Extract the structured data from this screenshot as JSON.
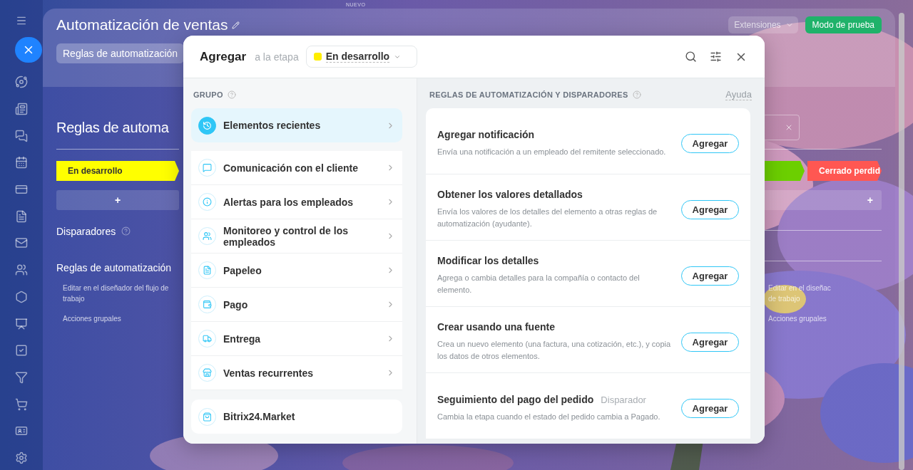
{
  "top_label": "NUEVO",
  "page": {
    "title": "Automatización de ventas",
    "tabs": [
      {
        "label": "Reglas de automatización",
        "selected": true
      }
    ],
    "extensions": "Extensiones",
    "test_mode": "Modo de prueba",
    "heading": "Reglas de automa",
    "stages": [
      {
        "name": "En desarrollo",
        "color": "#ffff00"
      },
      {
        "color": "#6ccf00"
      },
      {
        "name": "Cerrado perdid",
        "color": "#ff5752"
      }
    ],
    "add": "+",
    "sections": [
      "Disparadores",
      "Reglas de automatización"
    ],
    "left_links": [
      "Editar en el diseñador del flujo de trabajo",
      "Acciones grupales"
    ],
    "right_links": [
      "Editar en el diseñac",
      "de trabajo",
      "Acciones grupales"
    ]
  },
  "modal": {
    "title": "Agregar",
    "subtitle": "a la etapa",
    "stage": {
      "name": "En desarrollo",
      "color": "#ffee00"
    },
    "group_header": "GRUPO",
    "groups": [
      {
        "label": "Elementos recientes",
        "selected": true
      },
      {
        "label": "Comunicación con el cliente",
        "selected": false
      },
      {
        "label": "Alertas para los empleados",
        "selected": false
      },
      {
        "label": "Monitoreo y control de los empleados",
        "selected": false
      },
      {
        "label": "Papeleo",
        "selected": false
      },
      {
        "label": "Pago",
        "selected": false
      },
      {
        "label": "Entrega",
        "selected": false
      },
      {
        "label": "Ventas recurrentes",
        "selected": false
      }
    ],
    "market": "Bitrix24.Market",
    "rules_header": "REGLAS DE AUTOMATIZACIÓN Y DISPARADORES",
    "help": "Ayuda",
    "rules": [
      {
        "title": "Agregar notificación",
        "description": "Envía una notificación a un empleado del remitente seleccionado.",
        "button": "Agregar"
      },
      {
        "title": "Obtener los valores detallados",
        "description": "Envía los valores de los detalles del elemento a otras reglas de automatización (ayudante).",
        "button": "Agregar"
      },
      {
        "title": "Modificar los detalles",
        "description": "Agrega o cambia detalles para la compañía o contacto del elemento.",
        "button": "Agregar"
      },
      {
        "title": "Crear usando una fuente",
        "description": "Crea un nuevo elemento (una factura, una cotización, etc.), y copia los datos de otros elementos.",
        "button": "Agregar"
      },
      {
        "title": "Seguimiento del pago del pedido",
        "tag": "Disparador",
        "description": "Cambia la etapa cuando el estado del pedido cambia a Pagado.",
        "button": "Agregar"
      }
    ]
  }
}
